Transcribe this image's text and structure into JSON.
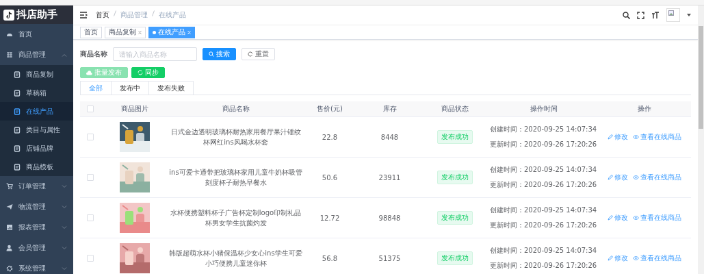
{
  "logo": {
    "text": "抖店助手"
  },
  "sidebar": {
    "items": [
      {
        "label": "首页",
        "selected": false
      },
      {
        "label": "商品管理",
        "selected": false,
        "expanded": true,
        "children": [
          {
            "label": "商品复制",
            "selected": false
          },
          {
            "label": "草稿箱",
            "selected": false
          },
          {
            "label": "在线产品",
            "selected": true
          },
          {
            "label": "类目与属性",
            "selected": false
          },
          {
            "label": "店铺品牌",
            "selected": false
          },
          {
            "label": "商品模板",
            "selected": false
          }
        ]
      },
      {
        "label": "订单管理",
        "selected": false,
        "expanded": false
      },
      {
        "label": "物流管理",
        "selected": false,
        "expanded": false
      },
      {
        "label": "报表管理",
        "selected": false,
        "expanded": false
      },
      {
        "label": "会员管理",
        "selected": false,
        "expanded": false
      },
      {
        "label": "系统管理",
        "selected": false,
        "expanded": false
      }
    ]
  },
  "breadcrumb": [
    "首页",
    "商品管理",
    "在线产品"
  ],
  "tags": [
    {
      "label": "首页",
      "selected": false,
      "closable": false
    },
    {
      "label": "商品复制",
      "selected": false,
      "closable": true
    },
    {
      "label": "在线产品",
      "selected": true,
      "closable": true
    }
  ],
  "search": {
    "label": "商品名称",
    "placeholder": "请输入商品名称",
    "search_button": "搜索",
    "reset_button": "重置"
  },
  "actions": [
    {
      "label": "批量发布",
      "kind": "publish",
      "disabled": true
    },
    {
      "label": "同步",
      "kind": "sync",
      "disabled": false
    }
  ],
  "tabs": [
    {
      "label": "全部",
      "selected": true
    },
    {
      "label": "发布中",
      "selected": false
    },
    {
      "label": "发布失败",
      "selected": false
    }
  ],
  "table": {
    "select_all_checked": false,
    "columns": [
      "商品图片",
      "商品名称",
      "售价(元)",
      "库存",
      "商品状态",
      "操作时间",
      "操作"
    ],
    "rows": [
      {
        "checked": false,
        "name": "日式金边透明玻璃杯耐热家用餐厅果汁锤纹杯网红ins风喝水杯套",
        "price": "22.8",
        "stock": "8448",
        "status": "发布成功",
        "created": "创建时间：2020-09-25 14:07:34",
        "updated": "更新时间：2020-09-26 17:20:26",
        "edit": "修改",
        "view": "查看在线商品"
      },
      {
        "checked": false,
        "name": "ins可爱卡通带把玻璃杯家用儿童牛奶杯吸管刻度杯子耐热早餐水",
        "price": "50.6",
        "stock": "23911",
        "status": "发布成功",
        "created": "创建时间：2020-09-25 14:07:34",
        "updated": "更新时间：2020-09-26 17:20:26",
        "edit": "修改",
        "view": "查看在线商品"
      },
      {
        "checked": false,
        "name": "水杯便携塑料杯子广告杯定制logo印制礼品杯男女学生抗菌灼发",
        "price": "12.72",
        "stock": "98848",
        "status": "发布成功",
        "created": "创建时间：2020-09-25 14:07:34",
        "updated": "更新时间：2020-09-26 17:20:26",
        "edit": "修改",
        "view": "查看在线商品"
      },
      {
        "checked": false,
        "name": "韩版超萌水杯小猪保温杯少女心ins学生可爱小巧便携儿童迷你杯",
        "price": "56.8",
        "stock": "51375",
        "status": "发布成功",
        "created": "创建时间：2020-09-25 14:07:34",
        "updated": "更新时间：2020-09-26 17:20:26",
        "edit": "修改",
        "view": "查看在线商品"
      }
    ]
  }
}
